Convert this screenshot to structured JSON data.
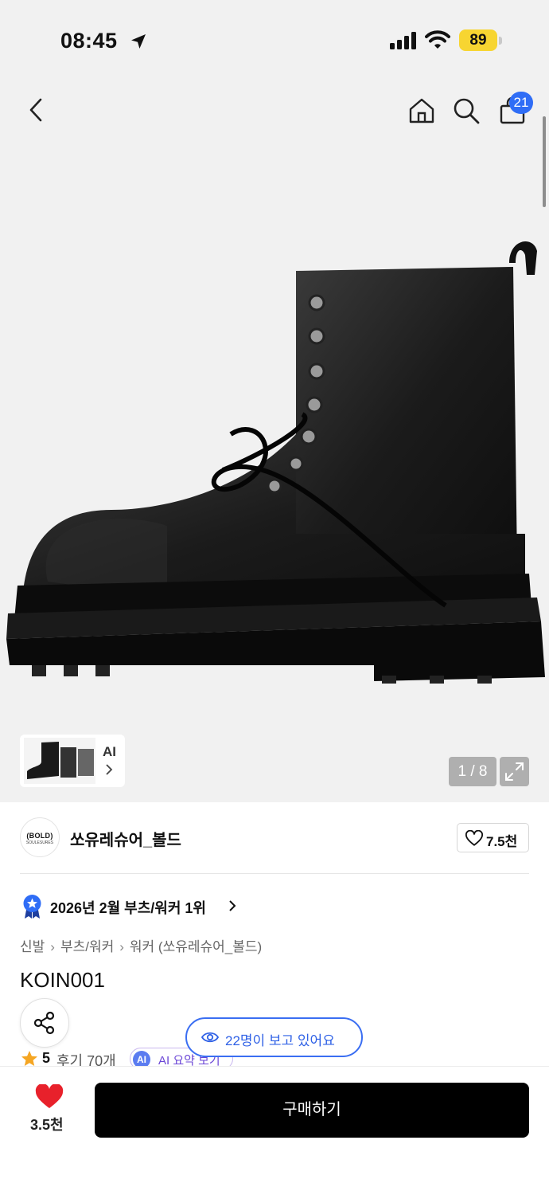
{
  "status_bar": {
    "time": "08:45",
    "battery": "89",
    "location_icon": "location-arrow-icon",
    "signal_icon": "cellular-signal-icon",
    "wifi_icon": "wifi-icon"
  },
  "nav": {
    "back_icon": "chevron-left-icon",
    "home_icon": "home-icon",
    "search_icon": "search-icon",
    "cart_icon": "shopping-bag-icon",
    "cart_badge": "21",
    "badge_color": "#2f6df6"
  },
  "gallery": {
    "thumb_label": "AI",
    "counter": "1 / 8",
    "expand_icon": "expand-icon"
  },
  "brand": {
    "logo_text": "(BOLD)",
    "logo_subtext": "SOULESURES",
    "name": "쏘유레슈어_볼드",
    "like_count": "7.5천"
  },
  "ranking": {
    "text": "2026년 2월 부츠/워커 1위"
  },
  "breadcrumb": [
    "신발",
    "부츠/워커",
    "워커 (쏘유레슈어_볼드)"
  ],
  "product": {
    "title": "KOIN001"
  },
  "viewers": {
    "text": "22명이 보고 있어요",
    "accent": "#2f61e6"
  },
  "rating": {
    "score": "5",
    "review_link": "후기 70개",
    "ai_badge": "AI",
    "ai_summary": "AI 요약 보기"
  },
  "bottom_bar": {
    "favorite_count": "3.5천",
    "heart_color": "#e8212b",
    "buy_label": "구매하기"
  }
}
